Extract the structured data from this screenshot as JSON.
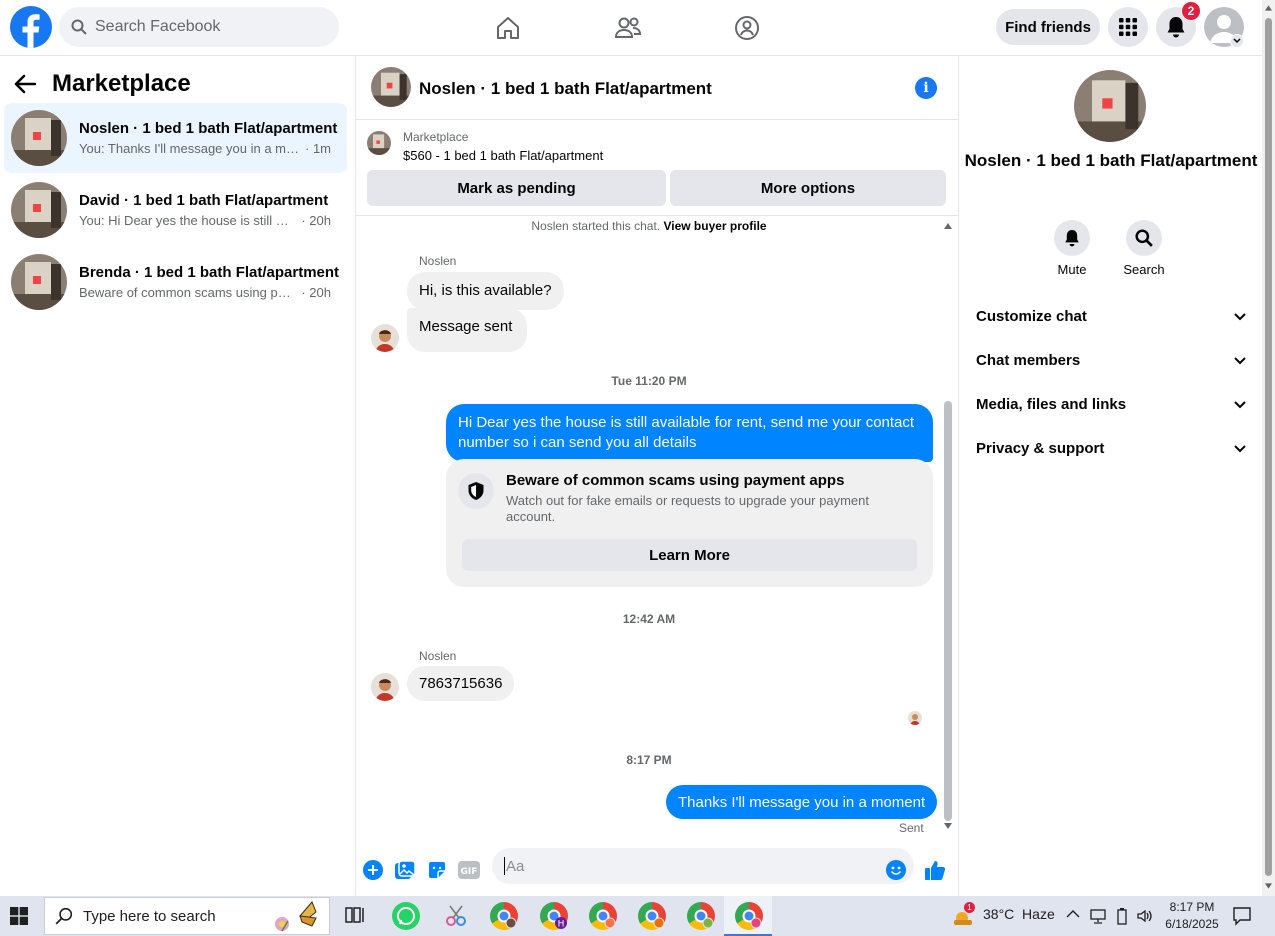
{
  "topbar": {
    "search_placeholder": "Search Facebook",
    "find_friends": "Find friends",
    "notifications_count": "2"
  },
  "sidebar": {
    "title": "Marketplace",
    "conversations": [
      {
        "name": "Noslen · 1 bed 1 bath Flat/apartment",
        "preview": "You: Thanks I'll message you in a mo...",
        "time": "· 1m"
      },
      {
        "name": "David · 1 bed 1 bath Flat/apartment",
        "preview": "You: Hi Dear yes the house is still ava...",
        "time": "· 20h"
      },
      {
        "name": "Brenda · 1 bed 1 bath Flat/apartment",
        "preview": "Beware of common scams using pay...",
        "time": "· 20h"
      }
    ]
  },
  "chat": {
    "title": "Noslen · 1 bed 1 bath Flat/apartment",
    "listing_source": "Marketplace",
    "listing_title": "$560 - 1 bed 1 bath Flat/apartment",
    "mark_pending": "Mark as pending",
    "more_options": "More options",
    "started_text": "Noslen started this chat.",
    "view_profile": "View buyer profile",
    "sender_name_1": "Noslen",
    "msg_in_1": "Hi, is this available?",
    "msg_in_2": "Message sent",
    "time_1": "Tue 11:20 PM",
    "msg_out_1": "Hi Dear yes the house is still available for rent, send me your contact number so i can send you all details",
    "warning_title": "Beware of common scams using payment apps",
    "warning_desc": "Watch out for fake emails or requests to upgrade your payment account.",
    "learn_more": "Learn More",
    "time_2": "12:42 AM",
    "sender_name_2": "Noslen",
    "msg_in_3": "7863715636",
    "time_3": "8:17 PM",
    "msg_out_2": "Thanks I'll message you in a moment",
    "sent_status": "Sent",
    "composer_placeholder": "Aa"
  },
  "details": {
    "name": "Noslen · 1 bed 1 bath Flat/apartment",
    "mute": "Mute",
    "search": "Search",
    "sections": [
      "Customize chat",
      "Chat members",
      "Media, files and links",
      "Privacy & support"
    ]
  },
  "taskbar": {
    "search_placeholder": "Type here to search",
    "weather": "38°C  Haze",
    "weather_badge": "1",
    "time": "8:17 PM",
    "date": "6/18/2025",
    "hangouts_letter": "H"
  },
  "colors": {
    "brand": "#1877f2",
    "outgoing_bubble": "#0084ff",
    "incoming_bubble": "#f0f0f0",
    "active_conversation": "#ebf5ff",
    "badge": "#e41e3f"
  }
}
